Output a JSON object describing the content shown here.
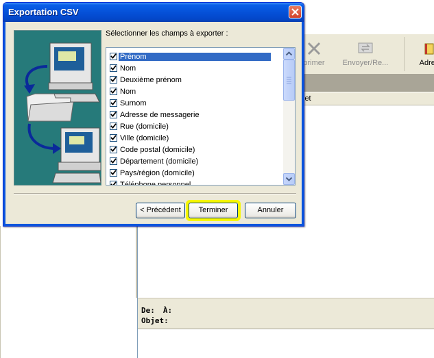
{
  "background": {
    "toolbar": [
      {
        "label": "primer",
        "icon": "delete-x-icon"
      },
      {
        "label": "Envoyer/Re...",
        "icon": "send-receive-icon"
      },
      {
        "label": "Adres",
        "icon": "address-book-icon"
      }
    ],
    "column_header": "jet",
    "preview": {
      "from_label": "De:",
      "to_label": "À:",
      "subject_label": "Objet:"
    }
  },
  "dialog": {
    "title": "Exportation CSV",
    "prompt": "Sélectionner les champs à exporter :",
    "fields": [
      {
        "label": "Prénom",
        "checked": true,
        "selected": true
      },
      {
        "label": "Nom",
        "checked": true
      },
      {
        "label": "Deuxième prénom",
        "checked": true
      },
      {
        "label": "Nom",
        "checked": true
      },
      {
        "label": "Surnom",
        "checked": true
      },
      {
        "label": "Adresse de messagerie",
        "checked": true
      },
      {
        "label": "Rue (domicile)",
        "checked": true
      },
      {
        "label": "Ville (domicile)",
        "checked": true
      },
      {
        "label": "Code postal (domicile)",
        "checked": true
      },
      {
        "label": "Département (domicile)",
        "checked": true
      },
      {
        "label": "Pays/région (domicile)",
        "checked": true
      },
      {
        "label": "Téléphone personnel",
        "checked": true
      }
    ],
    "buttons": {
      "previous": "< Précédent",
      "finish": "Terminer",
      "cancel": "Annuler"
    },
    "colors": {
      "title_bar": "#0551d8",
      "selection": "#316ac5",
      "highlight": "#f7f700",
      "illustration_bg": "#267a7a"
    }
  }
}
